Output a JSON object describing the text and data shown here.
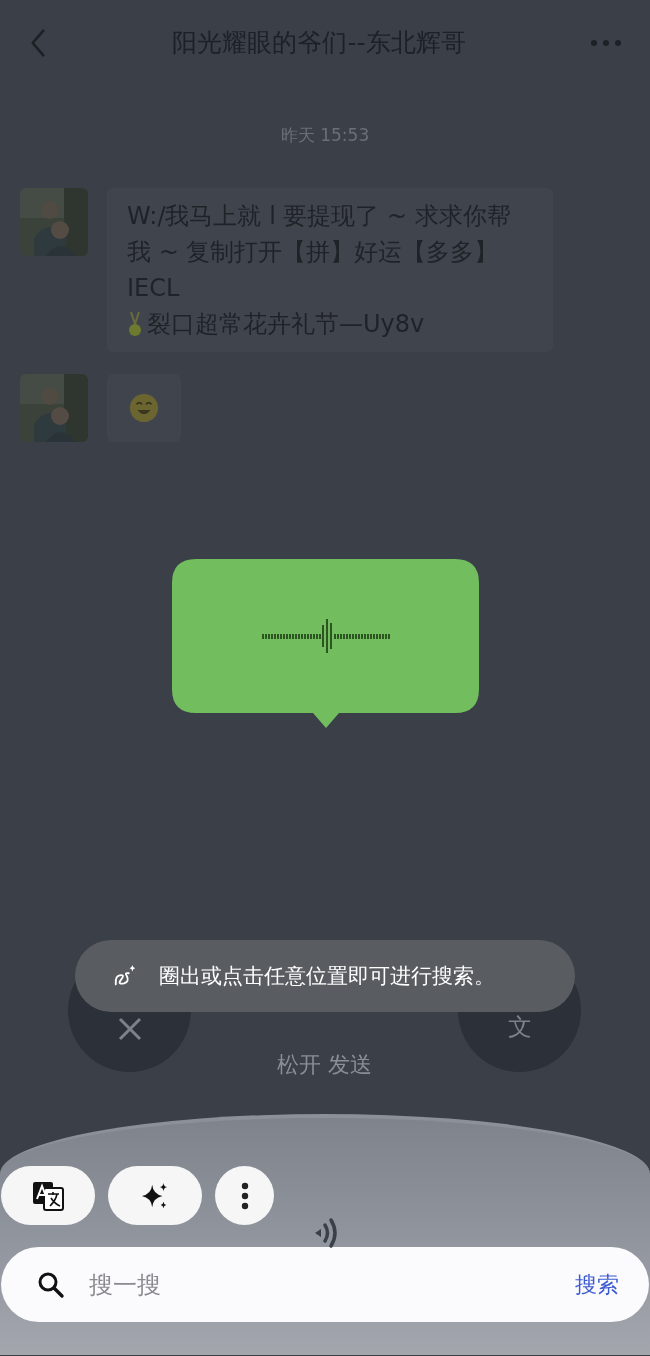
{
  "header": {
    "title": "阳光耀眼的爷们--东北辉哥"
  },
  "timestamp": "昨天 15:53",
  "messages": [
    {
      "kind": "text",
      "text_before": "W:/我马上就 l 要提现了 ~ 求求你帮我 ~ 复制打开【拼】好运【多多】IECL",
      "text_after": "裂口超常花卉礼节—Uy8v"
    },
    {
      "kind": "emoji"
    }
  ],
  "recording": {
    "hint": "松开 发送",
    "convert_label": "文"
  },
  "search_toast": {
    "text": "圈出或点击任意位置即可进行搜索。"
  },
  "search_bar": {
    "placeholder": "搜一搜",
    "button": "搜索"
  }
}
